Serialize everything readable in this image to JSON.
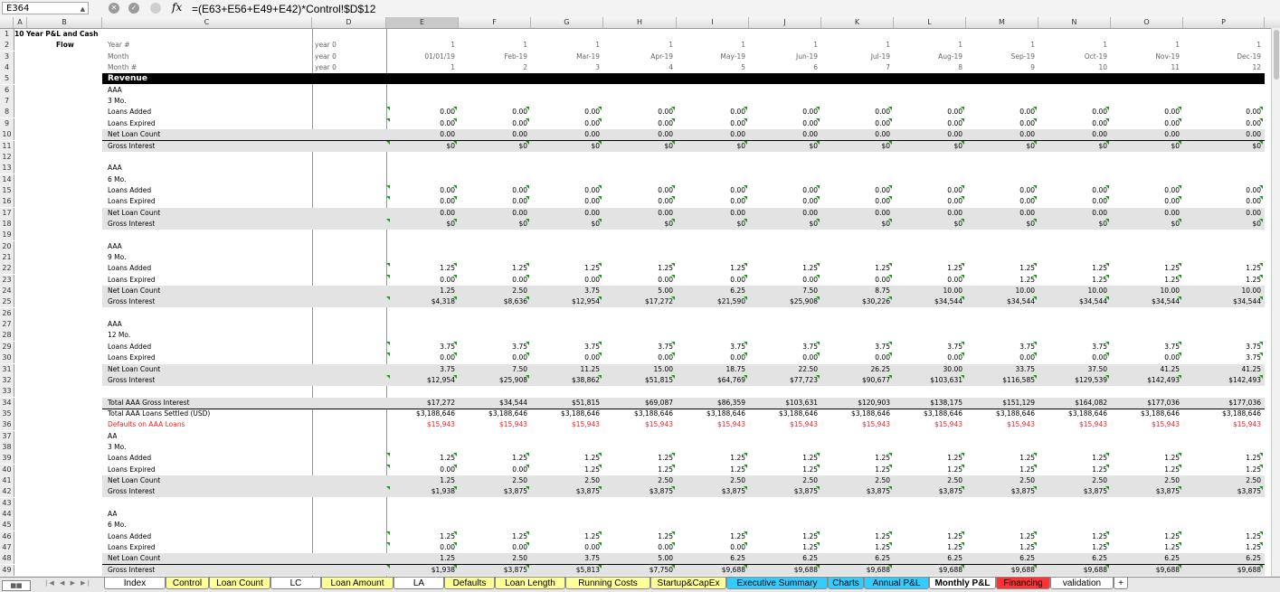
{
  "formula_bar": {
    "cell_ref": "E364",
    "fx": "fx",
    "formula": "=(E63+E56+E49+E42)*Control!$D$12"
  },
  "columns": [
    "A",
    "B",
    "C",
    "D",
    "E",
    "F",
    "G",
    "H",
    "I",
    "J",
    "K",
    "L",
    "M",
    "N",
    "O",
    "P"
  ],
  "header": {
    "title": [
      "10 Year P&L and Cash",
      "Flow"
    ],
    "labels": [
      "Year #",
      "Month",
      "Month #"
    ],
    "dvals": [
      "year 0",
      "year 0",
      "year 0"
    ],
    "year": [
      "1",
      "1",
      "1",
      "1",
      "1",
      "1",
      "1",
      "1",
      "1",
      "1",
      "1",
      "1"
    ],
    "month": [
      "01/01/19",
      "Feb-19",
      "Mar-19",
      "Apr-19",
      "May-19",
      "Jun-19",
      "Jul-19",
      "Aug-19",
      "Sep-19",
      "Oct-19",
      "Nov-19",
      "Dec-19"
    ],
    "monthnum": [
      "1",
      "2",
      "3",
      "4",
      "5",
      "6",
      "7",
      "8",
      "9",
      "10",
      "11",
      "12"
    ]
  },
  "rows": [
    {
      "n": "1"
    },
    {
      "n": "2"
    },
    {
      "n": "3"
    },
    {
      "n": "4"
    },
    {
      "n": "5",
      "type": "revenue",
      "label": "Revenue"
    },
    {
      "n": "6",
      "label": "AAA"
    },
    {
      "n": "7",
      "label": "3 Mo."
    },
    {
      "n": "8",
      "label": "Loans Added",
      "flag": true,
      "vals": [
        "0.00",
        "0.00",
        "0.00",
        "0.00",
        "0.00",
        "0.00",
        "0.00",
        "0.00",
        "0.00",
        "0.00",
        "0.00",
        "0.00"
      ]
    },
    {
      "n": "9",
      "label": "Loans Expired",
      "flag": true,
      "vals": [
        "0.00",
        "0.00",
        "0.00",
        "0.00",
        "0.00",
        "0.00",
        "0.00",
        "0.00",
        "0.00",
        "0.00",
        "0.00",
        "0.00"
      ]
    },
    {
      "n": "10",
      "label": "Net Loan Count",
      "style": "net",
      "vals": [
        "0.00",
        "0.00",
        "0.00",
        "0.00",
        "0.00",
        "0.00",
        "0.00",
        "0.00",
        "0.00",
        "0.00",
        "0.00",
        "0.00"
      ]
    },
    {
      "n": "11",
      "label": "Gross Interest",
      "style": "gross",
      "flag": true,
      "vals": [
        "$0",
        "$0",
        "$0",
        "$0",
        "$0",
        "$0",
        "$0",
        "$0",
        "$0",
        "$0",
        "$0",
        "$0"
      ]
    },
    {
      "n": "12"
    },
    {
      "n": "13",
      "label": "AAA"
    },
    {
      "n": "14",
      "label": "6 Mo."
    },
    {
      "n": "15",
      "label": "Loans Added",
      "flag": true,
      "vals": [
        "0.00",
        "0.00",
        "0.00",
        "0.00",
        "0.00",
        "0.00",
        "0.00",
        "0.00",
        "0.00",
        "0.00",
        "0.00",
        "0.00"
      ]
    },
    {
      "n": "16",
      "label": "Loans Expired",
      "flag": true,
      "vals": [
        "0.00",
        "0.00",
        "0.00",
        "0.00",
        "0.00",
        "0.00",
        "0.00",
        "0.00",
        "0.00",
        "0.00",
        "0.00",
        "0.00"
      ]
    },
    {
      "n": "17",
      "label": "Net Loan Count",
      "style": "net",
      "vals": [
        "0.00",
        "0.00",
        "0.00",
        "0.00",
        "0.00",
        "0.00",
        "0.00",
        "0.00",
        "0.00",
        "0.00",
        "0.00",
        "0.00"
      ]
    },
    {
      "n": "18",
      "label": "Gross Interest",
      "style": "gross",
      "flag": true,
      "vals": [
        "$0",
        "$0",
        "$0",
        "$0",
        "$0",
        "$0",
        "$0",
        "$0",
        "$0",
        "$0",
        "$0",
        "$0"
      ]
    },
    {
      "n": "19"
    },
    {
      "n": "20",
      "label": "AAA"
    },
    {
      "n": "21",
      "label": "9 Mo."
    },
    {
      "n": "22",
      "label": "Loans Added",
      "flag": true,
      "vals": [
        "1.25",
        "1.25",
        "1.25",
        "1.25",
        "1.25",
        "1.25",
        "1.25",
        "1.25",
        "1.25",
        "1.25",
        "1.25",
        "1.25"
      ]
    },
    {
      "n": "23",
      "label": "Loans Expired",
      "flag": true,
      "vals": [
        "0.00",
        "0.00",
        "0.00",
        "0.00",
        "0.00",
        "0.00",
        "0.00",
        "0.00",
        "1.25",
        "1.25",
        "1.25",
        "1.25"
      ]
    },
    {
      "n": "24",
      "label": "Net Loan Count",
      "style": "net",
      "vals": [
        "1.25",
        "2.50",
        "3.75",
        "5.00",
        "6.25",
        "7.50",
        "8.75",
        "10.00",
        "10.00",
        "10.00",
        "10.00",
        "10.00"
      ]
    },
    {
      "n": "25",
      "label": "Gross Interest",
      "style": "gross",
      "flag": true,
      "vals": [
        "$4,318",
        "$8,636",
        "$12,954",
        "$17,272",
        "$21,590",
        "$25,908",
        "$30,226",
        "$34,544",
        "$34,544",
        "$34,544",
        "$34,544",
        "$34,544"
      ]
    },
    {
      "n": "26"
    },
    {
      "n": "27",
      "label": "AAA"
    },
    {
      "n": "28",
      "label": "12 Mo."
    },
    {
      "n": "29",
      "label": "Loans Added",
      "flag": true,
      "vals": [
        "3.75",
        "3.75",
        "3.75",
        "3.75",
        "3.75",
        "3.75",
        "3.75",
        "3.75",
        "3.75",
        "3.75",
        "3.75",
        "3.75"
      ]
    },
    {
      "n": "30",
      "label": "Loans Expired",
      "flag": true,
      "vals": [
        "0.00",
        "0.00",
        "0.00",
        "0.00",
        "0.00",
        "0.00",
        "0.00",
        "0.00",
        "0.00",
        "0.00",
        "0.00",
        "3.75"
      ]
    },
    {
      "n": "31",
      "label": "Net Loan Count",
      "style": "net",
      "vals": [
        "3.75",
        "7.50",
        "11.25",
        "15.00",
        "18.75",
        "22.50",
        "26.25",
        "30.00",
        "33.75",
        "37.50",
        "41.25",
        "41.25"
      ]
    },
    {
      "n": "32",
      "label": "Gross Interest",
      "style": "gross",
      "flag": true,
      "vals": [
        "$12,954",
        "$25,908",
        "$38,862",
        "$51,815",
        "$64,769",
        "$77,723",
        "$90,677",
        "$103,631",
        "$116,585",
        "$129,539",
        "$142,493",
        "$142,493"
      ]
    },
    {
      "n": "33"
    },
    {
      "n": "34",
      "label": "Total AAA Gross Interest",
      "style": "net",
      "vals": [
        "$17,272",
        "$34,544",
        "$51,815",
        "$69,087",
        "$86,359",
        "$103,631",
        "$120,903",
        "$138,175",
        "$151,129",
        "$164,082",
        "$177,036",
        "$177,036"
      ]
    },
    {
      "n": "35",
      "label": "Total AAA Loans Settled (USD)",
      "vals": [
        "$3,188,646",
        "$3,188,646",
        "$3,188,646",
        "$3,188,646",
        "$3,188,646",
        "$3,188,646",
        "$3,188,646",
        "$3,188,646",
        "$3,188,646",
        "$3,188,646",
        "$3,188,646",
        "$3,188,646"
      ]
    },
    {
      "n": "36",
      "label": "Defaults on AAA Loans",
      "style": "red",
      "vals": [
        "$15,943",
        "$15,943",
        "$15,943",
        "$15,943",
        "$15,943",
        "$15,943",
        "$15,943",
        "$15,943",
        "$15,943",
        "$15,943",
        "$15,943",
        "$15,943"
      ]
    },
    {
      "n": "37",
      "label": "AA"
    },
    {
      "n": "38",
      "label": "3 Mo."
    },
    {
      "n": "39",
      "label": "Loans Added",
      "flag": true,
      "vals": [
        "1.25",
        "1.25",
        "1.25",
        "1.25",
        "1.25",
        "1.25",
        "1.25",
        "1.25",
        "1.25",
        "1.25",
        "1.25",
        "1.25"
      ]
    },
    {
      "n": "40",
      "label": "Loans Expired",
      "flag": true,
      "vals": [
        "0.00",
        "0.00",
        "1.25",
        "1.25",
        "1.25",
        "1.25",
        "1.25",
        "1.25",
        "1.25",
        "1.25",
        "1.25",
        "1.25"
      ]
    },
    {
      "n": "41",
      "label": "Net Loan Count",
      "style": "net",
      "vals": [
        "1.25",
        "2.50",
        "2.50",
        "2.50",
        "2.50",
        "2.50",
        "2.50",
        "2.50",
        "2.50",
        "2.50",
        "2.50",
        "2.50"
      ]
    },
    {
      "n": "42",
      "label": "Gross Interest",
      "style": "gross",
      "flag": true,
      "vals": [
        "$1,938",
        "$3,875",
        "$3,875",
        "$3,875",
        "$3,875",
        "$3,875",
        "$3,875",
        "$3,875",
        "$3,875",
        "$3,875",
        "$3,875",
        "$3,875"
      ]
    },
    {
      "n": "43"
    },
    {
      "n": "44",
      "label": "AA"
    },
    {
      "n": "45",
      "label": "6 Mo."
    },
    {
      "n": "46",
      "label": "Loans Added",
      "flag": true,
      "vals": [
        "1.25",
        "1.25",
        "1.25",
        "1.25",
        "1.25",
        "1.25",
        "1.25",
        "1.25",
        "1.25",
        "1.25",
        "1.25",
        "1.25"
      ]
    },
    {
      "n": "47",
      "label": "Loans Expired",
      "flag": true,
      "vals": [
        "0.00",
        "0.00",
        "0.00",
        "0.00",
        "0.00",
        "1.25",
        "1.25",
        "1.25",
        "1.25",
        "1.25",
        "1.25",
        "1.25"
      ]
    },
    {
      "n": "48",
      "label": "Net Loan Count",
      "style": "net",
      "vals": [
        "1.25",
        "2.50",
        "3.75",
        "5.00",
        "6.25",
        "6.25",
        "6.25",
        "6.25",
        "6.25",
        "6.25",
        "6.25",
        "6.25"
      ]
    },
    {
      "n": "49",
      "label": "Gross Interest",
      "style": "gross",
      "flag": true,
      "vals": [
        "$1,938",
        "$3,875",
        "$5,813",
        "$7,750",
        "$9,688",
        "$9,688",
        "$9,688",
        "$9,688",
        "$9,688",
        "$9,688",
        "$9,688",
        "$9,688"
      ]
    }
  ],
  "tabs": [
    {
      "label": "Index",
      "color": "#ffffff"
    },
    {
      "label": "Control",
      "color": "#ffff99"
    },
    {
      "label": "Loan Count",
      "color": "#ffff99"
    },
    {
      "label": "LC",
      "color": "#ffffff"
    },
    {
      "label": "Loan Amount",
      "color": "#ffff99"
    },
    {
      "label": "LA",
      "color": "#ffffff"
    },
    {
      "label": "Defaults",
      "color": "#ffff99"
    },
    {
      "label": "Loan Length",
      "color": "#ffff99"
    },
    {
      "label": "Running Costs",
      "color": "#ffff99"
    },
    {
      "label": "Startup&CapEx",
      "color": "#ffff99"
    },
    {
      "label": "Executive Summary",
      "color": "#33ccff"
    },
    {
      "label": "Charts",
      "color": "#33ccff"
    },
    {
      "label": "Annual P&L",
      "color": "#33ccff"
    },
    {
      "label": "Monthly P&L",
      "color": "#33ccff"
    },
    {
      "label": "Financing",
      "color": "#ff3333"
    },
    {
      "label": "validation",
      "color": "#ffffff"
    },
    {
      "label": "+",
      "color": "#ffffff"
    }
  ],
  "active_tab": "Monthly P&L"
}
